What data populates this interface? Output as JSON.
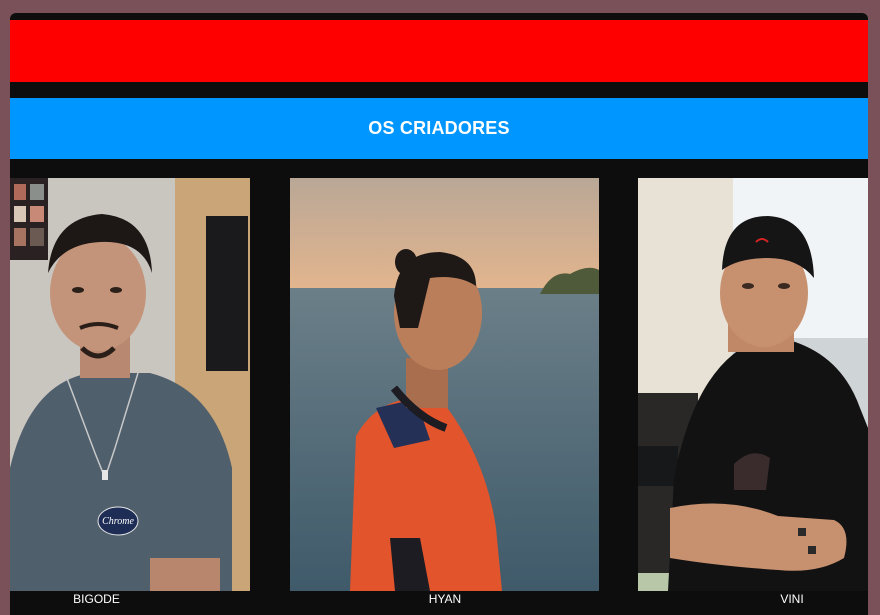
{
  "header": {
    "title": "OS CRIADORES"
  },
  "creators": [
    {
      "name": "BIGODE",
      "shirt_text": "Chrome"
    },
    {
      "name": "HYAN"
    },
    {
      "name": "VINI"
    }
  ],
  "colors": {
    "header_red": "#ff0000",
    "header_blue": "#0096ff",
    "background": "#0d0d0d",
    "outer": "#7a5158"
  }
}
